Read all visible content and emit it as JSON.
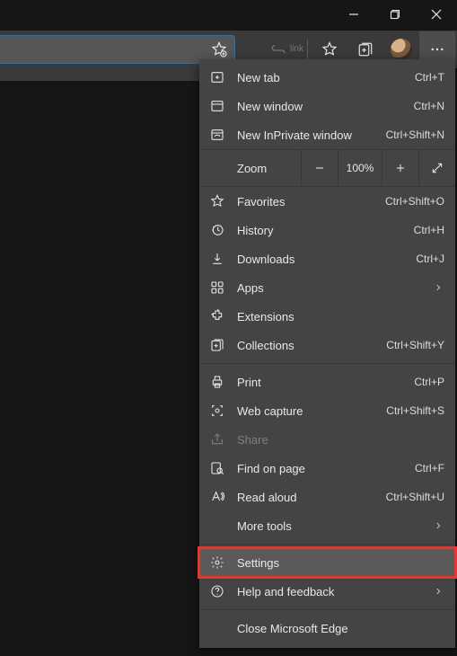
{
  "toolbar": {
    "link_label": "link"
  },
  "zoom": {
    "label": "Zoom",
    "percent": "100%"
  },
  "menu": {
    "new_tab": {
      "label": "New tab",
      "accel": "Ctrl+T"
    },
    "new_window": {
      "label": "New window",
      "accel": "Ctrl+N"
    },
    "new_inprivate": {
      "label": "New InPrivate window",
      "accel": "Ctrl+Shift+N"
    },
    "favorites": {
      "label": "Favorites",
      "accel": "Ctrl+Shift+O"
    },
    "history": {
      "label": "History",
      "accel": "Ctrl+H"
    },
    "downloads": {
      "label": "Downloads",
      "accel": "Ctrl+J"
    },
    "apps": {
      "label": "Apps"
    },
    "extensions": {
      "label": "Extensions"
    },
    "collections": {
      "label": "Collections",
      "accel": "Ctrl+Shift+Y"
    },
    "print": {
      "label": "Print",
      "accel": "Ctrl+P"
    },
    "web_capture": {
      "label": "Web capture",
      "accel": "Ctrl+Shift+S"
    },
    "share": {
      "label": "Share"
    },
    "find": {
      "label": "Find on page",
      "accel": "Ctrl+F"
    },
    "read_aloud": {
      "label": "Read aloud",
      "accel": "Ctrl+Shift+U"
    },
    "more_tools": {
      "label": "More tools"
    },
    "settings": {
      "label": "Settings"
    },
    "help": {
      "label": "Help and feedback"
    },
    "close": {
      "label": "Close Microsoft Edge"
    }
  }
}
